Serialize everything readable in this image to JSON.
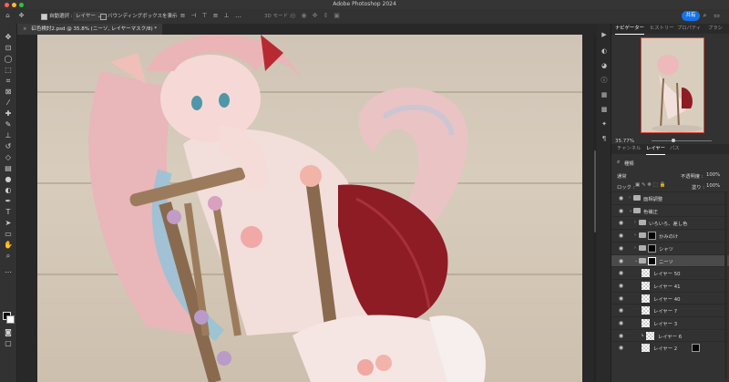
{
  "app": {
    "title": "Adobe Photoshop 2024",
    "traffic_colors": [
      "#ff5f57",
      "#febc2e",
      "#28c840"
    ]
  },
  "options_bar": {
    "auto_select_label": "自動選択 :",
    "layer_select": "レイヤー",
    "layer_select_caret": "⌄",
    "bounding_box_label": "バウンディングボックスを表示",
    "three_d_mode_label": "3D モード :",
    "share_label": "共有"
  },
  "document": {
    "tab_label": "矼色検討2.psd @ 35.8% (ニーソ, レイヤーマスク/8) *"
  },
  "navigator": {
    "tabs": [
      "ナビゲーター",
      "ヒストリー",
      "プロパティ",
      "ブラシ"
    ],
    "zoom": "35.77%"
  },
  "layers_panel": {
    "tabs": [
      "チャンネル",
      "レイヤー",
      "パス"
    ],
    "search_label": "種類",
    "blend_mode": "通常",
    "opacity_label": "不透明度 :",
    "opacity_value": "100%",
    "lock_label": "ロック :",
    "fill_label": "塗り :",
    "fill_value": "100%",
    "layers": [
      {
        "name": "面相調整",
        "kind": "folder",
        "selected": false
      },
      {
        "name": "色補正",
        "kind": "folder",
        "selected": false
      },
      {
        "name": "いろいろ、差し色",
        "kind": "folder",
        "selected": false
      },
      {
        "name": "かみのけ",
        "kind": "folder-mask",
        "selected": false
      },
      {
        "name": "シャツ",
        "kind": "folder-mask",
        "selected": false
      },
      {
        "name": "ニーソ",
        "kind": "folder-mask",
        "selected": true
      },
      {
        "name": "レイヤー 50",
        "kind": "pixel",
        "selected": false
      },
      {
        "name": "レイヤー 41",
        "kind": "pixel",
        "selected": false
      },
      {
        "name": "レイヤー 40",
        "kind": "pixel",
        "selected": false
      },
      {
        "name": "レイヤー 7",
        "kind": "pixel",
        "selected": false
      },
      {
        "name": "レイヤー 3",
        "kind": "pixel",
        "selected": false
      },
      {
        "name": "レイヤー 6",
        "kind": "pixel",
        "selected": false
      },
      {
        "name": "レイヤー 2",
        "kind": "pixel-mask",
        "selected": false
      }
    ]
  },
  "icons": {
    "home": "⌂",
    "move": "✥",
    "eye": "◉",
    "chevron": "›"
  }
}
